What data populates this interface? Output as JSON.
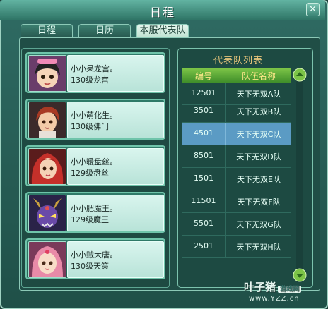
{
  "window": {
    "title": "日程",
    "close_glyph": "✕"
  },
  "tabs": [
    {
      "label": "日程",
      "active": false
    },
    {
      "label": "日历",
      "active": false
    },
    {
      "label": "本服代表队",
      "active": true
    }
  ],
  "players": [
    {
      "name": "小小呆龙宫。",
      "desc": "130级龙宫",
      "avatar": "girl-black-hair-pink-hat"
    },
    {
      "name": "小小萌化生。",
      "desc": "130级佛门",
      "avatar": "boy-red-hair"
    },
    {
      "name": "小小暖盘丝。",
      "desc": "129级盘丝",
      "avatar": "woman-red-hair"
    },
    {
      "name": "小小肥魔王。",
      "desc": "129级魔王",
      "avatar": "demon-horned"
    },
    {
      "name": "小小贼大唐。",
      "desc": "130级天策",
      "avatar": "girl-pink-hair"
    }
  ],
  "team_table": {
    "title": "代表队列表",
    "headers": {
      "id": "编号",
      "name": "队伍名称"
    },
    "rows": [
      {
        "id": "12501",
        "name": "天下无双A队",
        "selected": false
      },
      {
        "id": "3501",
        "name": "天下无双B队",
        "selected": false
      },
      {
        "id": "4501",
        "name": "天下无双C队",
        "selected": true
      },
      {
        "id": "8501",
        "name": "天下无双D队",
        "selected": false
      },
      {
        "id": "1501",
        "name": "天下无双E队",
        "selected": false
      },
      {
        "id": "11501",
        "name": "天下无双F队",
        "selected": false
      },
      {
        "id": "5501",
        "name": "天下无双G队",
        "selected": false
      },
      {
        "id": "2501",
        "name": "天下无双H队",
        "selected": false
      }
    ]
  },
  "watermark": {
    "brand": "叶子猪",
    "tag": "游戏网",
    "url": "www.YZZ.cn"
  },
  "colors": {
    "accent_green": "#7cc447",
    "header_text": "#ffe88a",
    "title_gold": "#e6c47a",
    "selected_row": "#5b9bc4"
  }
}
